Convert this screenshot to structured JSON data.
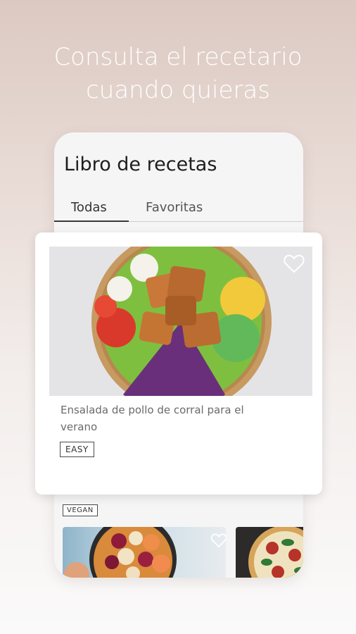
{
  "headline": {
    "line1": "Consulta el recetario",
    "line2": "cuando quieras"
  },
  "app": {
    "title": "Libro de recetas",
    "tabs": [
      {
        "label": "Todas",
        "active": true
      },
      {
        "label": "Favoritas",
        "active": false
      }
    ]
  },
  "featured_recipe": {
    "title": "Ensalada de pollo de corral para el verano",
    "tag": "EASY",
    "favorite_icon": "heart-outline-icon"
  },
  "next_recipe": {
    "tag": "VEGAN",
    "favorite_icon": "heart-outline-icon"
  },
  "colors": {
    "background_top": "#dcc9c2",
    "background_bottom": "#fbfafa",
    "text_dark": "#1e1e1e",
    "text_muted": "#6a6a6a"
  }
}
